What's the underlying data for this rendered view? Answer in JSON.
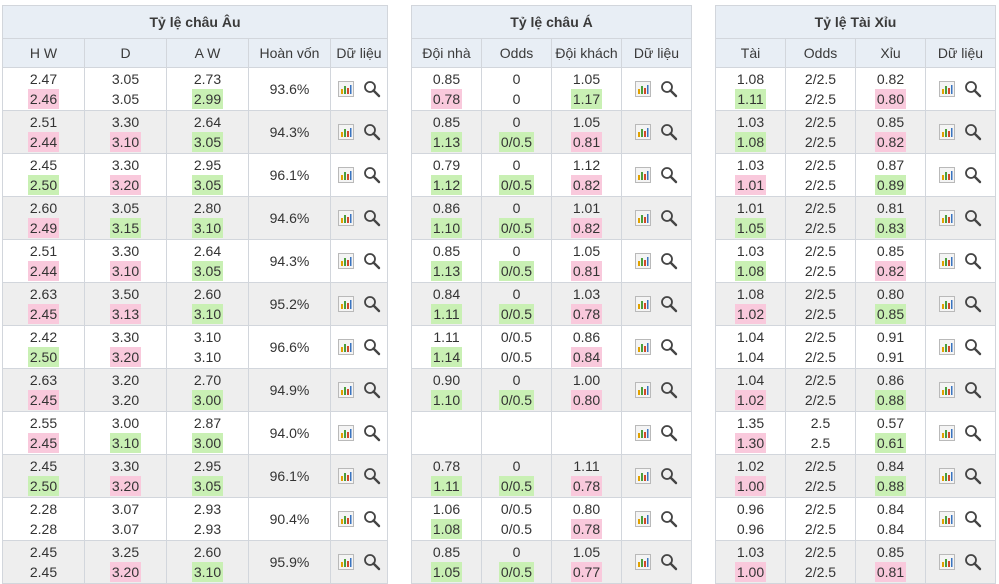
{
  "europe": {
    "title": "Tỷ lệ châu Âu",
    "headers": [
      "H W",
      "D",
      "A W",
      "Hoàn vốn",
      "Dữ liệu"
    ],
    "rows": [
      {
        "hw": [
          "2.47",
          "2.46"
        ],
        "d": [
          "3.05",
          "3.05"
        ],
        "aw": [
          "2.73",
          "2.99"
        ],
        "return": "93.6%",
        "hl": [
          [
            "",
            "down"
          ],
          [
            "",
            ""
          ],
          [
            "",
            "up"
          ]
        ]
      },
      {
        "hw": [
          "2.51",
          "2.44"
        ],
        "d": [
          "3.30",
          "3.10"
        ],
        "aw": [
          "2.64",
          "3.05"
        ],
        "return": "94.3%",
        "hl": [
          [
            "",
            "down"
          ],
          [
            "",
            "down"
          ],
          [
            "",
            "up"
          ]
        ]
      },
      {
        "hw": [
          "2.45",
          "2.50"
        ],
        "d": [
          "3.30",
          "3.20"
        ],
        "aw": [
          "2.95",
          "3.05"
        ],
        "return": "96.1%",
        "hl": [
          [
            "",
            "up"
          ],
          [
            "",
            "down"
          ],
          [
            "",
            "up"
          ]
        ]
      },
      {
        "hw": [
          "2.60",
          "2.49"
        ],
        "d": [
          "3.05",
          "3.15"
        ],
        "aw": [
          "2.80",
          "3.10"
        ],
        "return": "94.6%",
        "hl": [
          [
            "",
            "down"
          ],
          [
            "",
            "up"
          ],
          [
            "",
            "up"
          ]
        ]
      },
      {
        "hw": [
          "2.51",
          "2.44"
        ],
        "d": [
          "3.30",
          "3.10"
        ],
        "aw": [
          "2.64",
          "3.05"
        ],
        "return": "94.3%",
        "hl": [
          [
            "",
            "down"
          ],
          [
            "",
            "down"
          ],
          [
            "",
            "up"
          ]
        ]
      },
      {
        "hw": [
          "2.63",
          "2.45"
        ],
        "d": [
          "3.50",
          "3.13"
        ],
        "aw": [
          "2.60",
          "3.10"
        ],
        "return": "95.2%",
        "hl": [
          [
            "",
            "down"
          ],
          [
            "",
            "down"
          ],
          [
            "",
            "up"
          ]
        ]
      },
      {
        "hw": [
          "2.42",
          "2.50"
        ],
        "d": [
          "3.30",
          "3.20"
        ],
        "aw": [
          "3.10",
          "3.10"
        ],
        "return": "96.6%",
        "hl": [
          [
            "",
            "up"
          ],
          [
            "",
            "down"
          ],
          [
            "",
            ""
          ]
        ]
      },
      {
        "hw": [
          "2.63",
          "2.45"
        ],
        "d": [
          "3.20",
          "3.20"
        ],
        "aw": [
          "2.70",
          "3.00"
        ],
        "return": "94.9%",
        "hl": [
          [
            "",
            "down"
          ],
          [
            "",
            ""
          ],
          [
            "",
            "up"
          ]
        ]
      },
      {
        "hw": [
          "2.55",
          "2.45"
        ],
        "d": [
          "3.00",
          "3.10"
        ],
        "aw": [
          "2.87",
          "3.00"
        ],
        "return": "94.0%",
        "hl": [
          [
            "",
            "down"
          ],
          [
            "",
            "up"
          ],
          [
            "",
            "up"
          ]
        ]
      },
      {
        "hw": [
          "2.45",
          "2.50"
        ],
        "d": [
          "3.30",
          "3.20"
        ],
        "aw": [
          "2.95",
          "3.05"
        ],
        "return": "96.1%",
        "hl": [
          [
            "",
            "up"
          ],
          [
            "",
            "down"
          ],
          [
            "",
            "up"
          ]
        ]
      },
      {
        "hw": [
          "2.28",
          "2.28"
        ],
        "d": [
          "3.07",
          "3.07"
        ],
        "aw": [
          "2.93",
          "2.93"
        ],
        "return": "90.4%",
        "hl": [
          [
            "",
            ""
          ],
          [
            "",
            ""
          ],
          [
            "",
            ""
          ]
        ]
      },
      {
        "hw": [
          "2.45",
          "2.45"
        ],
        "d": [
          "3.25",
          "3.20"
        ],
        "aw": [
          "2.60",
          "3.10"
        ],
        "return": "95.9%",
        "hl": [
          [
            "",
            ""
          ],
          [
            "",
            "down"
          ],
          [
            "",
            "up"
          ]
        ]
      }
    ]
  },
  "asia": {
    "title": "Tỷ lệ châu Á",
    "headers": [
      "Đội nhà",
      "Odds",
      "Đội khách",
      "Dữ liệu"
    ],
    "rows": [
      {
        "home": [
          "0.85",
          "0.78"
        ],
        "odds": [
          "0",
          "0"
        ],
        "away": [
          "1.05",
          "1.17"
        ],
        "hl": [
          [
            "",
            "down"
          ],
          [
            "",
            ""
          ],
          [
            "",
            "up"
          ]
        ]
      },
      {
        "home": [
          "0.85",
          "1.13"
        ],
        "odds": [
          "0",
          "0/0.5"
        ],
        "away": [
          "1.05",
          "0.81"
        ],
        "hl": [
          [
            "",
            "up"
          ],
          [
            "",
            "up"
          ],
          [
            "",
            "down"
          ]
        ]
      },
      {
        "home": [
          "0.79",
          "1.12"
        ],
        "odds": [
          "0",
          "0/0.5"
        ],
        "away": [
          "1.12",
          "0.82"
        ],
        "hl": [
          [
            "",
            "up"
          ],
          [
            "",
            "up"
          ],
          [
            "",
            "down"
          ]
        ]
      },
      {
        "home": [
          "0.86",
          "1.10"
        ],
        "odds": [
          "0",
          "0/0.5"
        ],
        "away": [
          "1.01",
          "0.82"
        ],
        "hl": [
          [
            "",
            "up"
          ],
          [
            "",
            "up"
          ],
          [
            "",
            "down"
          ]
        ]
      },
      {
        "home": [
          "0.85",
          "1.13"
        ],
        "odds": [
          "0",
          "0/0.5"
        ],
        "away": [
          "1.05",
          "0.81"
        ],
        "hl": [
          [
            "",
            "up"
          ],
          [
            "",
            "up"
          ],
          [
            "",
            "down"
          ]
        ]
      },
      {
        "home": [
          "0.84",
          "1.11"
        ],
        "odds": [
          "0",
          "0/0.5"
        ],
        "away": [
          "1.03",
          "0.78"
        ],
        "hl": [
          [
            "",
            "up"
          ],
          [
            "",
            "up"
          ],
          [
            "",
            "down"
          ]
        ]
      },
      {
        "home": [
          "1.11",
          "1.14"
        ],
        "odds": [
          "0/0.5",
          "0/0.5"
        ],
        "away": [
          "0.86",
          "0.84"
        ],
        "hl": [
          [
            "",
            "up"
          ],
          [
            "",
            ""
          ],
          [
            "",
            "down"
          ]
        ]
      },
      {
        "home": [
          "0.90",
          "1.10"
        ],
        "odds": [
          "0",
          "0/0.5"
        ],
        "away": [
          "1.00",
          "0.80"
        ],
        "hl": [
          [
            "",
            "up"
          ],
          [
            "",
            "up"
          ],
          [
            "",
            "down"
          ]
        ]
      },
      {
        "home": [
          "",
          ""
        ],
        "odds": [
          "",
          ""
        ],
        "away": [
          "",
          ""
        ],
        "hl": [
          [
            "",
            ""
          ],
          [
            "",
            ""
          ],
          [
            "",
            ""
          ]
        ]
      },
      {
        "home": [
          "0.78",
          "1.11"
        ],
        "odds": [
          "0",
          "0/0.5"
        ],
        "away": [
          "1.11",
          "0.78"
        ],
        "hl": [
          [
            "",
            "up"
          ],
          [
            "",
            "up"
          ],
          [
            "",
            "down"
          ]
        ]
      },
      {
        "home": [
          "1.06",
          "1.08"
        ],
        "odds": [
          "0/0.5",
          "0/0.5"
        ],
        "away": [
          "0.80",
          "0.78"
        ],
        "hl": [
          [
            "",
            "up"
          ],
          [
            "",
            ""
          ],
          [
            "",
            "down"
          ]
        ]
      },
      {
        "home": [
          "0.85",
          "1.05"
        ],
        "odds": [
          "0",
          "0/0.5"
        ],
        "away": [
          "1.05",
          "0.77"
        ],
        "hl": [
          [
            "",
            "up"
          ],
          [
            "",
            "up"
          ],
          [
            "",
            "down"
          ]
        ]
      }
    ]
  },
  "overunder": {
    "title": "Tỷ lệ Tài Xỉu",
    "headers": [
      "Tài",
      "Odds",
      "Xỉu",
      "Dữ liệu"
    ],
    "rows": [
      {
        "over": [
          "1.08",
          "1.11"
        ],
        "odds": [
          "2/2.5",
          "2/2.5"
        ],
        "under": [
          "0.82",
          "0.80"
        ],
        "hl": [
          [
            "",
            "up"
          ],
          [
            "",
            ""
          ],
          [
            "",
            "down"
          ]
        ]
      },
      {
        "over": [
          "1.03",
          "1.08"
        ],
        "odds": [
          "2/2.5",
          "2/2.5"
        ],
        "under": [
          "0.85",
          "0.82"
        ],
        "hl": [
          [
            "",
            "up"
          ],
          [
            "",
            ""
          ],
          [
            "",
            "down"
          ]
        ]
      },
      {
        "over": [
          "1.03",
          "1.01"
        ],
        "odds": [
          "2/2.5",
          "2/2.5"
        ],
        "under": [
          "0.87",
          "0.89"
        ],
        "hl": [
          [
            "",
            "down"
          ],
          [
            "",
            ""
          ],
          [
            "",
            "up"
          ]
        ]
      },
      {
        "over": [
          "1.01",
          "1.05"
        ],
        "odds": [
          "2/2.5",
          "2/2.5"
        ],
        "under": [
          "0.81",
          "0.83"
        ],
        "hl": [
          [
            "",
            "up"
          ],
          [
            "",
            ""
          ],
          [
            "",
            "up"
          ]
        ]
      },
      {
        "over": [
          "1.03",
          "1.08"
        ],
        "odds": [
          "2/2.5",
          "2/2.5"
        ],
        "under": [
          "0.85",
          "0.82"
        ],
        "hl": [
          [
            "",
            "up"
          ],
          [
            "",
            ""
          ],
          [
            "",
            "down"
          ]
        ]
      },
      {
        "over": [
          "1.08",
          "1.02"
        ],
        "odds": [
          "2/2.5",
          "2/2.5"
        ],
        "under": [
          "0.80",
          "0.85"
        ],
        "hl": [
          [
            "",
            "down"
          ],
          [
            "",
            ""
          ],
          [
            "",
            "up"
          ]
        ]
      },
      {
        "over": [
          "1.04",
          "1.04"
        ],
        "odds": [
          "2/2.5",
          "2/2.5"
        ],
        "under": [
          "0.91",
          "0.91"
        ],
        "hl": [
          [
            "",
            ""
          ],
          [
            "",
            ""
          ],
          [
            "",
            ""
          ]
        ]
      },
      {
        "over": [
          "1.04",
          "1.02"
        ],
        "odds": [
          "2/2.5",
          "2/2.5"
        ],
        "under": [
          "0.86",
          "0.88"
        ],
        "hl": [
          [
            "",
            "down"
          ],
          [
            "",
            ""
          ],
          [
            "",
            "up"
          ]
        ]
      },
      {
        "over": [
          "1.35",
          "1.30"
        ],
        "odds": [
          "2.5",
          "2.5"
        ],
        "under": [
          "0.57",
          "0.61"
        ],
        "hl": [
          [
            "",
            "down"
          ],
          [
            "",
            ""
          ],
          [
            "",
            "up"
          ]
        ]
      },
      {
        "over": [
          "1.02",
          "1.00"
        ],
        "odds": [
          "2/2.5",
          "2/2.5"
        ],
        "under": [
          "0.84",
          "0.88"
        ],
        "hl": [
          [
            "",
            "down"
          ],
          [
            "",
            ""
          ],
          [
            "",
            "up"
          ]
        ]
      },
      {
        "over": [
          "0.96",
          "0.96"
        ],
        "odds": [
          "2/2.5",
          "2/2.5"
        ],
        "under": [
          "0.84",
          "0.84"
        ],
        "hl": [
          [
            "",
            ""
          ],
          [
            "",
            ""
          ],
          [
            "",
            ""
          ]
        ]
      },
      {
        "over": [
          "1.03",
          "1.00"
        ],
        "odds": [
          "2/2.5",
          "2/2.5"
        ],
        "under": [
          "0.85",
          "0.81"
        ],
        "hl": [
          [
            "",
            "down"
          ],
          [
            "",
            ""
          ],
          [
            "",
            "down"
          ]
        ]
      }
    ]
  },
  "colors": {
    "header_bg": "#e8eef5",
    "alt_row_bg": "#eeeeee",
    "up_highlight": "#c9f0b4",
    "down_highlight": "#f9c9dc"
  },
  "icons": {
    "chart": "bar-chart-icon",
    "search": "search-icon"
  }
}
